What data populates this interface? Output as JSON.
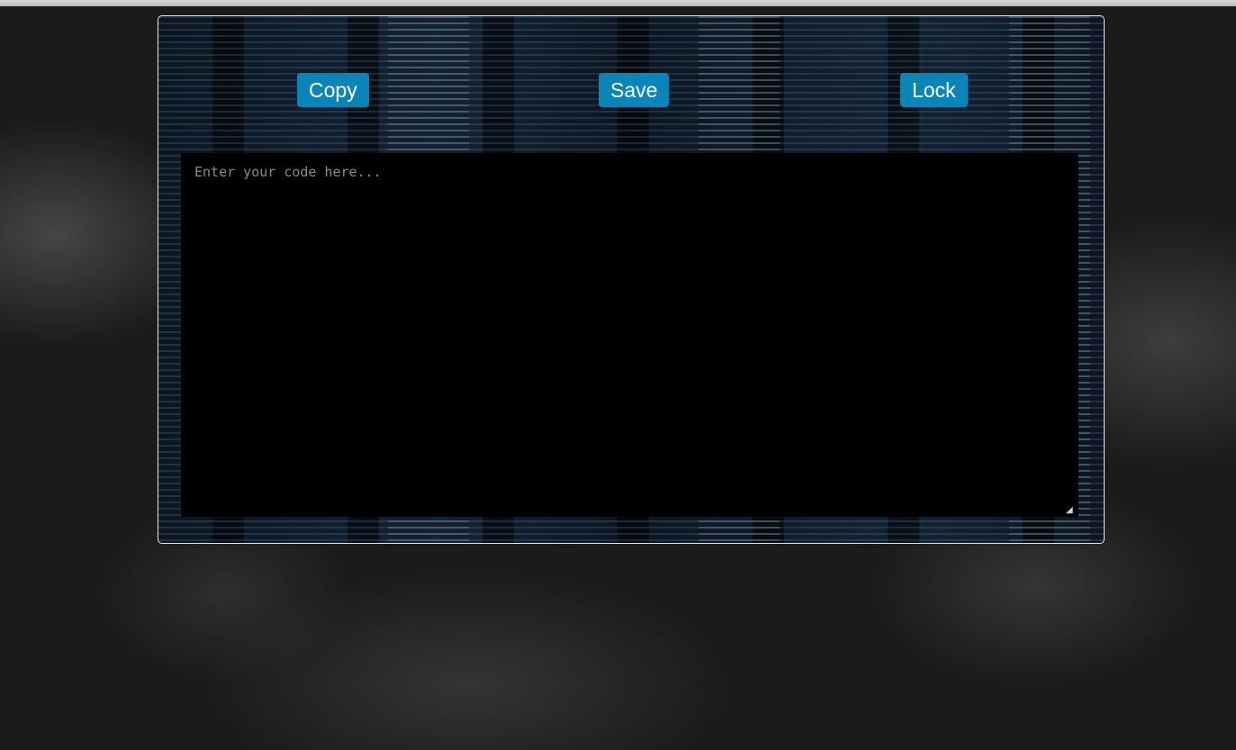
{
  "toolbar": {
    "copy_label": "Copy",
    "save_label": "Save",
    "lock_label": "Lock"
  },
  "editor": {
    "placeholder": "Enter your code here...",
    "value": ""
  },
  "colors": {
    "button_bg": "#0b84b8",
    "button_text": "#ffffff",
    "editor_bg": "#000000",
    "panel_border": "#e6e6e6"
  },
  "icons": {
    "resize_handle": "resize-grip-icon"
  }
}
